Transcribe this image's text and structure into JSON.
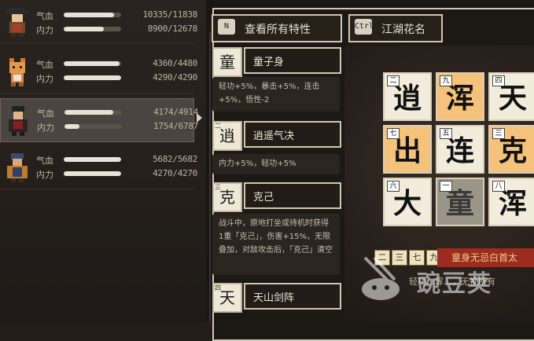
{
  "characters": [
    {
      "name": "char-1",
      "hp_label": "气血",
      "hp": "10335/11838",
      "hp_frac": 0.873,
      "mp_label": "内力",
      "mp": "8900/12678",
      "mp_frac": 0.702
    },
    {
      "name": "char-2",
      "hp_label": "气血",
      "hp": "4360/4480",
      "hp_frac": 0.973,
      "mp_label": "内力",
      "mp": "4290/4290",
      "mp_frac": 1.0
    },
    {
      "name": "char-3",
      "hp_label": "气血",
      "hp": "4174/4914",
      "hp_frac": 0.849,
      "mp_label": "内力",
      "mp": "1754/6787",
      "mp_frac": 0.258
    },
    {
      "name": "char-4",
      "hp_label": "气血",
      "hp": "5682/5682",
      "hp_frac": 1.0,
      "mp_label": "内力",
      "mp": "4270/4270",
      "mp_frac": 1.0
    }
  ],
  "buttons": {
    "view_all": {
      "key": "N",
      "label": "查看所有特性"
    },
    "jianghu": {
      "key": "Ctrl",
      "label": "江湖花名"
    }
  },
  "traits": [
    {
      "icon": "童",
      "name": "童子身",
      "desc": "轻功+5%，暴击+5%，连击+5%，悟性-2"
    },
    {
      "icon": "逍",
      "corner": "二",
      "name": "逍遥气决",
      "desc": "内力+5%，轻功+5%"
    },
    {
      "icon": "克",
      "corner": "三",
      "name": "克己",
      "desc": "战斗中，原地打坐或待机时获得1重「克己」，伤害+15%，无限叠加，对敌攻击后，「克己」清空"
    },
    {
      "icon": "天",
      "corner": "四",
      "name": "天山剑阵",
      "desc": ""
    }
  ],
  "grid": [
    {
      "num": "二",
      "char": "逍",
      "style": "light"
    },
    {
      "num": "九",
      "char": "浑",
      "style": "gold"
    },
    {
      "num": "四",
      "char": "天",
      "style": "light"
    },
    {
      "num": "七",
      "char": "出",
      "style": "gold"
    },
    {
      "num": "五",
      "char": "连",
      "style": "light"
    },
    {
      "num": "三",
      "char": "克",
      "style": "gold"
    },
    {
      "num": "六",
      "char": "大",
      "style": "light"
    },
    {
      "num": "一",
      "char": "童",
      "style": "gray"
    },
    {
      "num": "八",
      "char": "浑",
      "style": "light"
    }
  ],
  "chips": [
    "二",
    "三",
    "七",
    "九"
  ],
  "banner": "童身无忌白首太",
  "bottom_text": "轻功…浑…，无视所有",
  "watermark": "豌豆荚",
  "colors": {
    "gold": "#f4c27a",
    "paper": "#f2ecdc",
    "banner": "#9b2c1f",
    "bg": "#221d19"
  }
}
